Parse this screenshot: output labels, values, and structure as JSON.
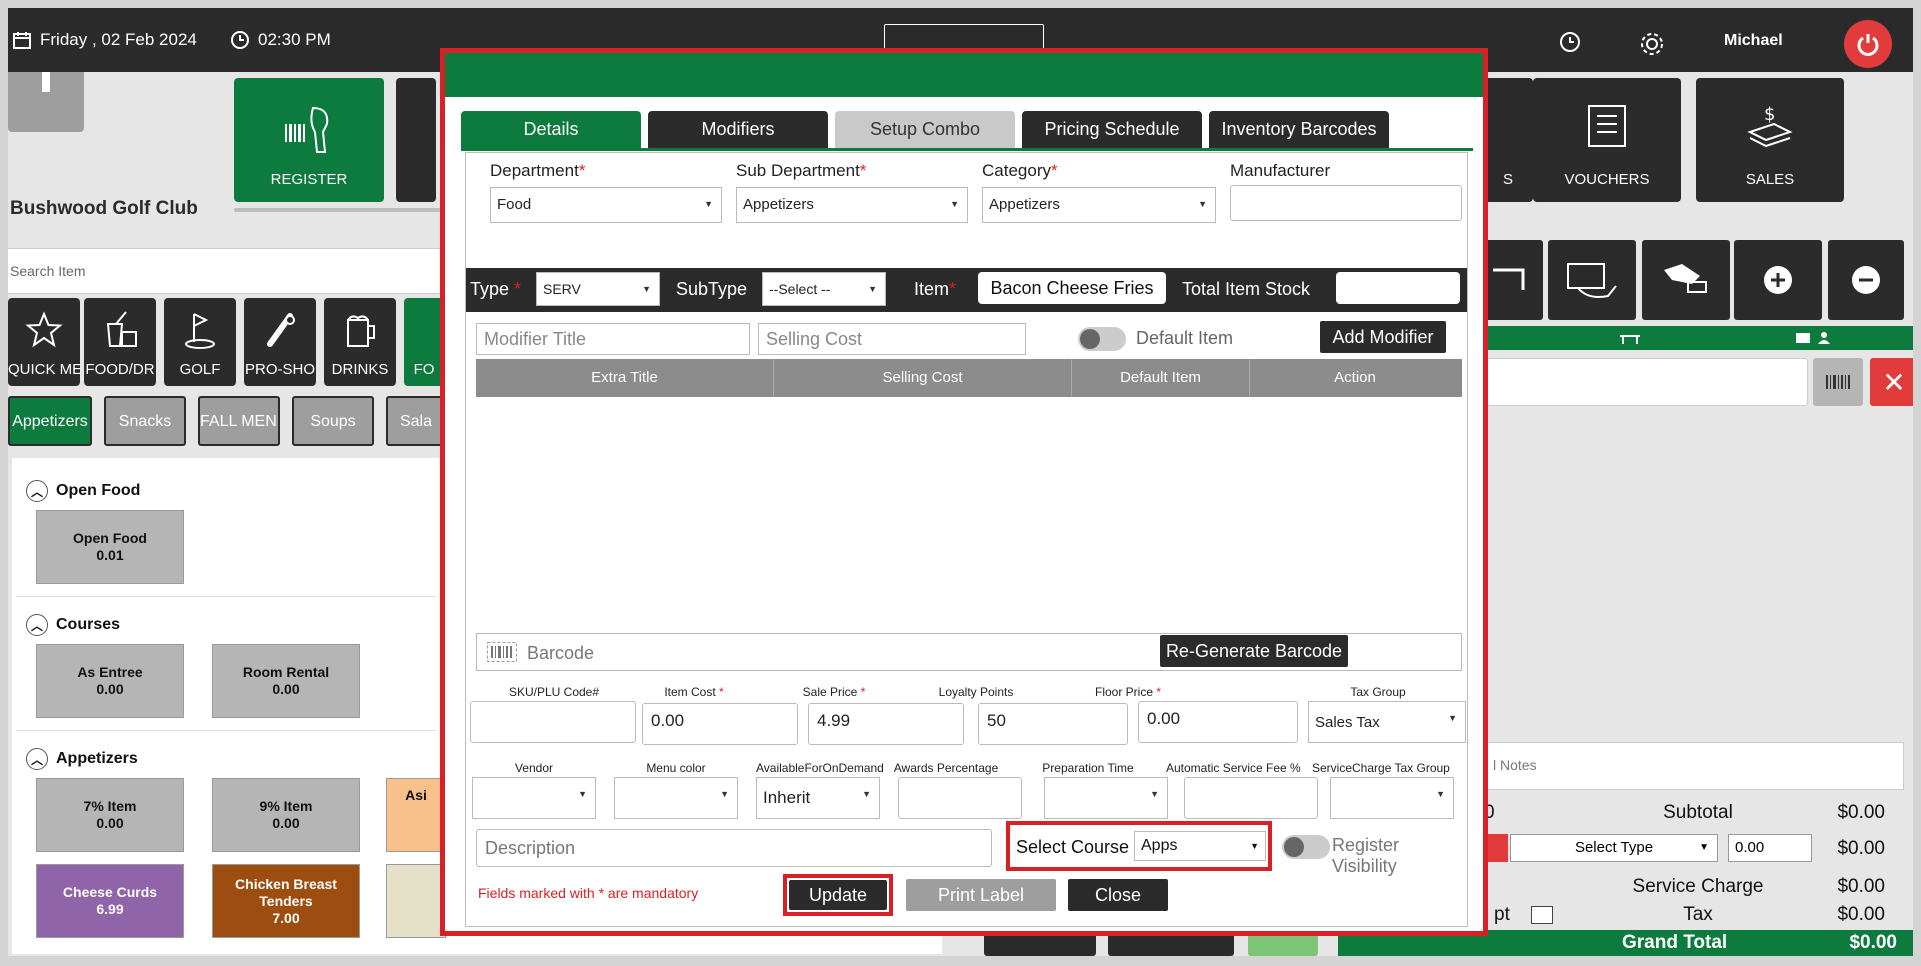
{
  "topbar": {
    "date": "Friday ,  02 Feb 2024",
    "time": "02:30 PM",
    "user": "Michael"
  },
  "club_name": "Bushwood Golf Club",
  "nav": {
    "register": "REGISTER",
    "s_fragment": "S",
    "vouchers": "VOUCHERS",
    "sales": "SALES"
  },
  "search_placeholder": "Search Item",
  "categories": [
    {
      "label": "QUICK ME",
      "icon": "star-icon"
    },
    {
      "label": "FOOD/DR",
      "icon": "food-drink-icon"
    },
    {
      "label": "GOLF",
      "icon": "golf-icon"
    },
    {
      "label": "PRO-SHO",
      "icon": "pro-shop-icon"
    },
    {
      "label": "DRINKS",
      "icon": "drinks-icon"
    },
    {
      "label": "FO",
      "icon": "food-icon"
    }
  ],
  "sub_tabs": [
    "Appetizers",
    "Snacks",
    "FALL MENU",
    "Soups",
    "Sala"
  ],
  "groups": {
    "open_food": "Open Food",
    "courses": "Courses",
    "appetizers": "Appetizers"
  },
  "items": {
    "open_food": {
      "name": "Open Food",
      "price": "0.01"
    },
    "as_entree": {
      "name": "As Entree",
      "price": "0.00"
    },
    "room_rental": {
      "name": "Room Rental",
      "price": "0.00"
    },
    "seven_item": {
      "name": "7% Item",
      "price": "0.00"
    },
    "nine_item": {
      "name": "9% Item",
      "price": "0.00"
    },
    "asi_item": {
      "name": "Asi",
      "price": ""
    },
    "cheese_curds": {
      "name": "Cheese Curds",
      "price": "6.99"
    },
    "chicken_tenders": {
      "name": "Chicken Breast Tenders",
      "price": "7.00"
    }
  },
  "right_panel": {
    "notes_placeholder": "l Notes",
    "subtotal_label": "Subtotal",
    "subtotal_value": "$0.00",
    "select_type": "Select Type",
    "select_type_value": "0.00",
    "discount_value": "$0.00",
    "service_charge_label": "Service Charge",
    "service_charge_value": "$0.00",
    "exempt_fragment": "pt",
    "tax_label": "Tax",
    "tax_value": "$0.00",
    "grand_total_label": "Grand Total",
    "grand_total_value": "$0.00",
    "row0_fragment": "0"
  },
  "modal": {
    "tabs": [
      "Details",
      "Modifiers",
      "Setup Combo",
      "Pricing Schedule",
      "Inventory Barcodes"
    ],
    "department_label": "Department",
    "department_value": "Food",
    "sub_department_label": "Sub Department",
    "sub_department_value": "Appetizers",
    "category_label": "Category",
    "category_value": "Appetizers",
    "manufacturer_label": "Manufacturer",
    "manufacturer_value": "",
    "type_label": "Type",
    "type_value": "SERV",
    "subtype_label": "SubType",
    "subtype_value": "--Select --",
    "item_label": "Item",
    "item_value": "Bacon Cheese Fries",
    "total_stock_label": "Total Item Stock",
    "modifier_title_ph": "Modifier Title",
    "selling_cost_ph": "Selling Cost",
    "default_item_label": "Default Item",
    "add_modifier": "Add Modifier",
    "grid_headers": [
      "Extra Title",
      "Selling Cost",
      "Default Item",
      "Action"
    ],
    "barcode_ph": "Barcode",
    "regen_barcode": "Re-Generate Barcode",
    "fields": {
      "sku_label": "SKU/PLU Code#",
      "sku_value": "",
      "item_cost_label": "Item Cost",
      "item_cost_value": "0.00",
      "sale_price_label": "Sale Price",
      "sale_price_value": "4.99",
      "loyalty_label": "Loyalty Points",
      "loyalty_value": "50",
      "floor_price_label": "Floor Price",
      "floor_price_value": "0.00",
      "tax_group_label": "Tax Group",
      "tax_group_value": "Sales Tax",
      "vendor_label": "Vendor",
      "menu_color_label": "Menu color",
      "on_demand_label": "AvailableForOnDemand",
      "on_demand_value": "Inherit",
      "awards_label": "Awards Percentage",
      "prep_time_label": "Preparation Time",
      "auto_fee_label": "Automatic Service Fee %",
      "svc_tax_group_label": "ServiceCharge Tax Group"
    },
    "description_ph": "Description",
    "select_course_label": "Select Course",
    "select_course_value": "Apps",
    "register_visibility": "Register Visibility",
    "mandatory_note": "Fields marked with * are mandatory",
    "update": "Update",
    "print_label": "Print Label",
    "close": "Close"
  }
}
